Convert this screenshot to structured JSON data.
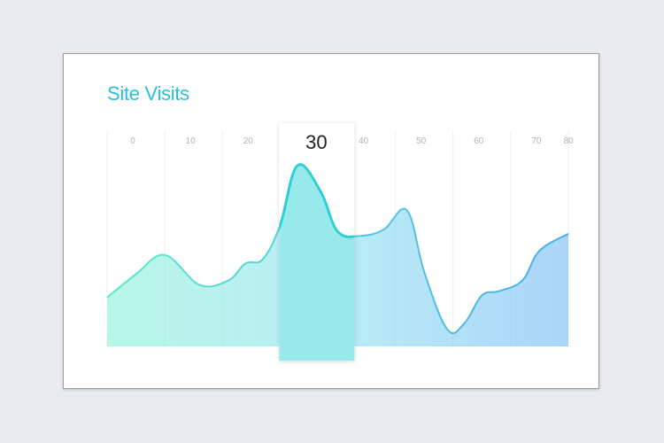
{
  "card": {
    "title": "Site Visits"
  },
  "chart_data": {
    "type": "area",
    "title": "Site Visits",
    "xlabel": "",
    "ylabel": "",
    "x_ticks": [
      0,
      10,
      20,
      30,
      40,
      50,
      60,
      70,
      80
    ],
    "xlim": [
      0,
      80
    ],
    "ylim": [
      0,
      100
    ],
    "grid": "vertical",
    "series": [
      {
        "x": [
          0,
          5,
          10,
          16,
          21,
          24,
          27,
          30,
          33,
          37,
          40,
          44,
          48,
          52,
          55,
          59,
          62,
          65,
          68,
          72,
          75,
          80
        ],
        "values": [
          23,
          34,
          43,
          29,
          31,
          39,
          41,
          57,
          85,
          73,
          54,
          52,
          55,
          64,
          35,
          8,
          11,
          24,
          26,
          31,
          45,
          53
        ]
      }
    ],
    "highlight": {
      "x": 30,
      "label": "30"
    },
    "colors": {
      "title": "#29bfe0",
      "gradient_start": "#7ff0d2",
      "gradient_mid": "#7fdbee",
      "gradient_end": "#7dbef5",
      "line_start": "#5fe8cc",
      "line_end": "#4aaee8",
      "highlight_fill": "#98e9ec",
      "highlight_line": "#2fcfd5",
      "gridline": "#efefef",
      "tick_label": "#b3b3b3"
    }
  }
}
